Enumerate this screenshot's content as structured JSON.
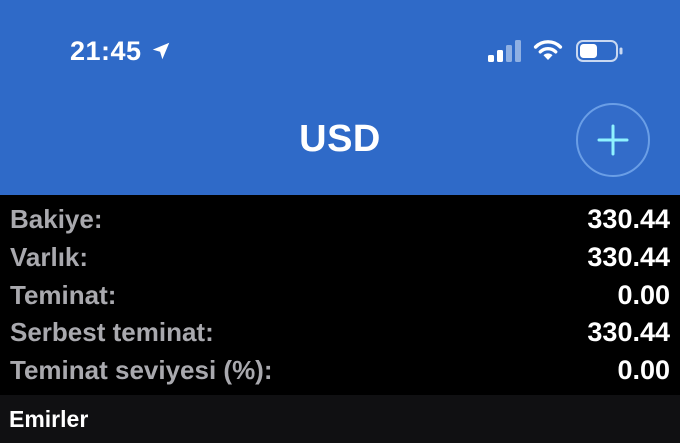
{
  "status_bar": {
    "time": "21:45",
    "location_icon": "location-arrow-icon",
    "signal_icon": "cellular-signal-icon",
    "wifi_icon": "wifi-icon",
    "battery_icon": "battery-icon"
  },
  "header": {
    "title": "USD",
    "add_icon": "plus-icon",
    "background_color": "#2f6ac8"
  },
  "account_summary": [
    {
      "label": "Bakiye:",
      "value": "330.44"
    },
    {
      "label": "Varlık:",
      "value": "330.44"
    },
    {
      "label": "Teminat:",
      "value": "0.00"
    },
    {
      "label": "Serbest teminat:",
      "value": "330.44"
    },
    {
      "label": "Teminat seviyesi (%):",
      "value": "0.00"
    }
  ],
  "orders": {
    "title": "Emirler"
  }
}
